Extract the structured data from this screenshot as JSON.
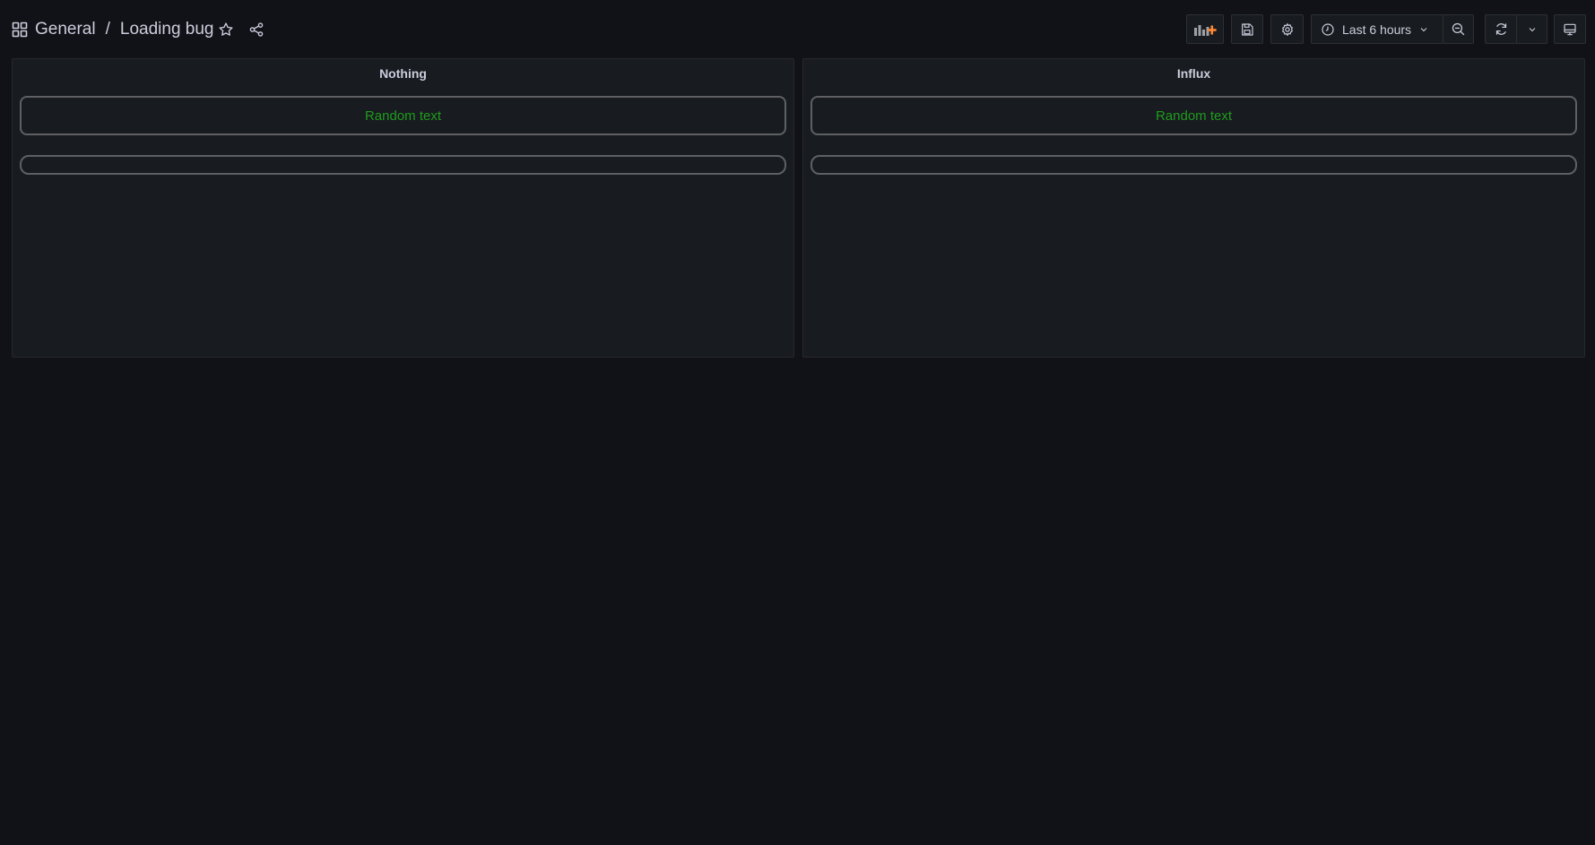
{
  "breadcrumb": {
    "folder": "General",
    "separator": "/",
    "dashboard": "Loading bug"
  },
  "toolbar": {
    "time_range": "Last 6 hours"
  },
  "panels": [
    {
      "title": "Nothing",
      "text": "Random text"
    },
    {
      "title": "Influx",
      "text": "Random text"
    }
  ],
  "colors": {
    "background": "#111217",
    "panel": "#181b1f",
    "text_green": "#1f9b1f",
    "add_panel_accent": "#ff8833"
  }
}
